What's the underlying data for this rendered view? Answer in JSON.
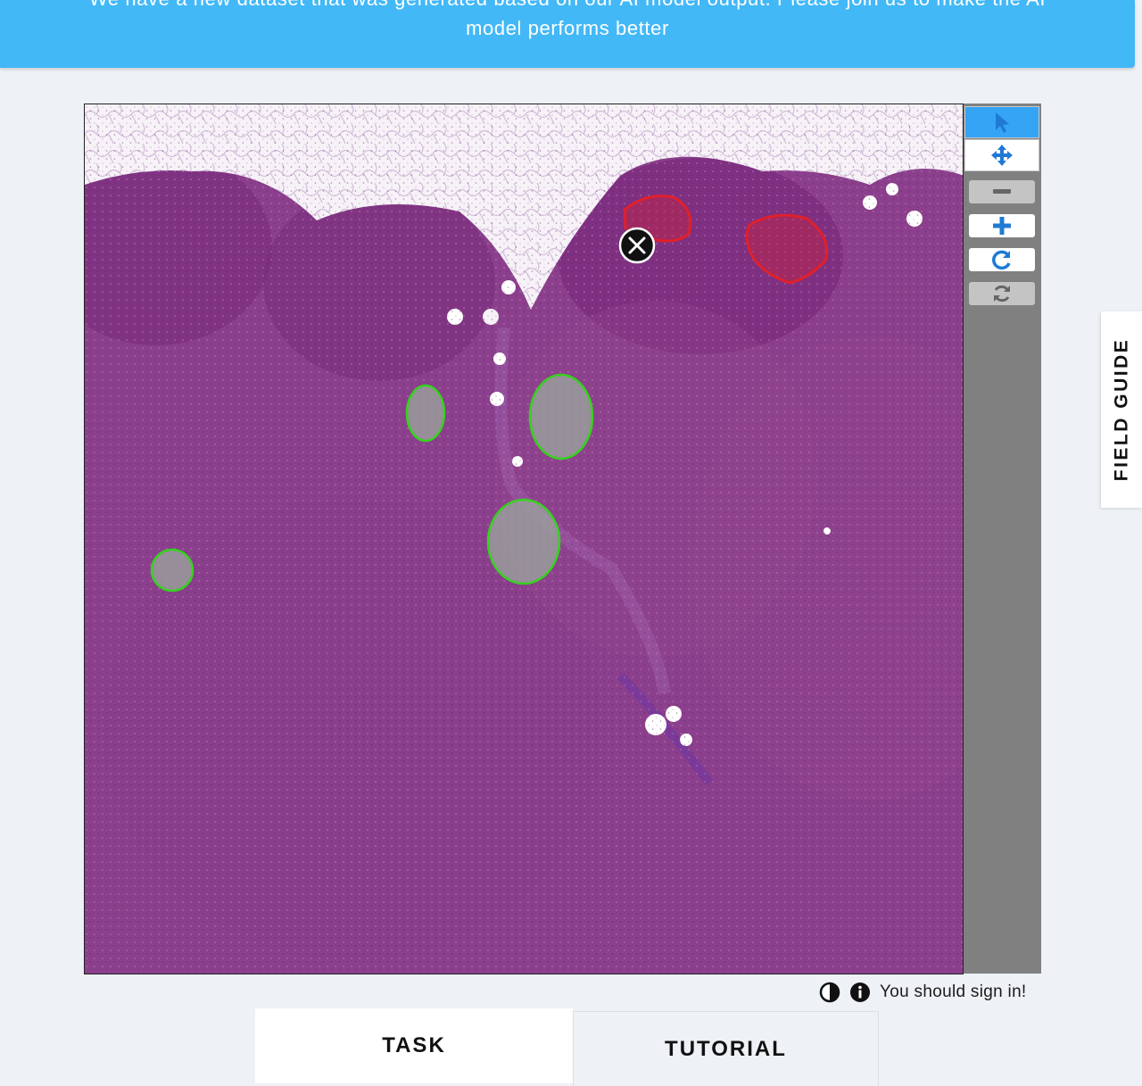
{
  "banner": {
    "line1": "We have a new dataset that was generated based on our AI model output. Please join us to make the AI",
    "line2": "model performs better"
  },
  "viewer": {
    "image": "histology-tissue-slide",
    "annotation_colors": {
      "rejected": "#e0202a",
      "accepted": "#35d21e"
    },
    "annotations": {
      "red": 2,
      "green": 4
    }
  },
  "toolbar": {
    "tools": [
      {
        "name": "select",
        "icon": "cursor-arrow-icon",
        "active": true
      },
      {
        "name": "pan",
        "icon": "move-arrows-icon",
        "active": false
      }
    ],
    "actions": [
      {
        "name": "zoom-out",
        "icon": "minus-icon",
        "enabled": false
      },
      {
        "name": "zoom-in",
        "icon": "plus-icon",
        "enabled": true
      },
      {
        "name": "rotate",
        "icon": "rotate-icon",
        "enabled": true
      },
      {
        "name": "reset",
        "icon": "refresh-icon",
        "enabled": false
      }
    ]
  },
  "status": {
    "message": "You should sign in!"
  },
  "tabs": {
    "task": "TASK",
    "tutorial": "TUTORIAL"
  },
  "field_guide": {
    "label": "FIELD GUIDE"
  },
  "colors": {
    "banner": "#43b8f7",
    "accent": "#1f7ad6",
    "toolbar_bg": "#808080",
    "page_bg": "#eef1f5"
  }
}
